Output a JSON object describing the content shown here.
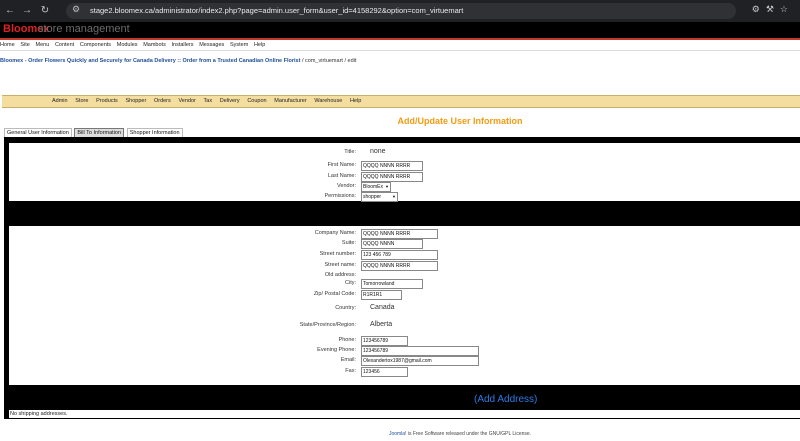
{
  "browser": {
    "url": "stage2.bloomex.ca/administrator/index2.php?page=admin.user_form&user_id=4158292&option=com_virtuemart"
  },
  "admin": {
    "brand": "Bloomex",
    "brand_sub": "store management",
    "menu": [
      "Home",
      "Site",
      "Menu",
      "Content",
      "Components",
      "Modules",
      "Mambots",
      "Installers",
      "Messages",
      "System",
      "Help"
    ]
  },
  "pathway": {
    "link": "Bloomex - Order Flowers Quickly and Securely for Canada Delivery :: Order from a Trusted Canadian Online Florist",
    "rest": " / com_virtuemart / edit"
  },
  "vm_menu": [
    "Admin",
    "Store",
    "Products",
    "Shopper",
    "Orders",
    "Vendor",
    "Tax",
    "Delivery",
    "Coupon",
    "Manufacturer",
    "Warehouse",
    "Help"
  ],
  "page_title": "Add/Update User Information",
  "tabs": [
    "General User Information",
    "Bill To Information",
    "Shopper Information"
  ],
  "shopper": {
    "title_label": "Title:",
    "title_value": "none",
    "first_name_label": "First Name:",
    "first_name": "QQQQ NNNN RRRR",
    "last_name_label": "Last Name:",
    "last_name": "QQQQ NNNN RRRR",
    "vendor_label": "Vendor:",
    "vendor": "BloomEx",
    "permissions_label": "Permissions:",
    "permissions": "shopper"
  },
  "address": {
    "company_label": "Company Name:",
    "company": "QQQQ NNNN RRRR",
    "suite_label": "Suite:",
    "suite": "QQQQ NNNN",
    "street_number_label": "Street number:",
    "street_number": "123 456 789",
    "street_name_label": "Street name:",
    "street_name": "QQQQ NNNN RRRR",
    "old_address_label": "Old address:",
    "city_label": "City:",
    "city": "Tomorrowland",
    "zip_label": "Zip/ Postal Code:",
    "zip": "R1R1R1",
    "country_label": "Country:",
    "country": "Canada",
    "state_label": "State/Province/Region:",
    "state": "Alberta",
    "phone_label": "Phone:",
    "phone": "123456789",
    "evening_phone_label": "Evening Phone:",
    "evening_phone": "123456789",
    "email_label": "Email:",
    "email": "Olexandertox1987@gmail.com",
    "fax_label": "Fax:",
    "fax": "123456"
  },
  "add_address": "(Add Address)",
  "no_shipping": "No shipping addresses.",
  "footer": {
    "link": "Joomla!",
    "rest": " is Free Software released under the GNU/GPL License."
  }
}
